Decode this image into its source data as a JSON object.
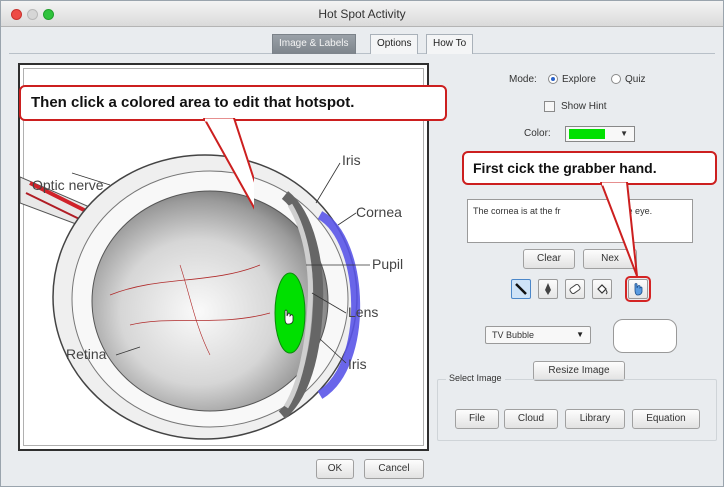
{
  "window": {
    "title": "Hot Spot Activity"
  },
  "tabs": [
    {
      "label": "Image & Labels",
      "active": true
    },
    {
      "label": "Options",
      "active": false
    },
    {
      "label": "How To",
      "active": false
    }
  ],
  "image": {
    "labels": {
      "optic_nerve": "Optic nerve",
      "iris_top": "Iris",
      "cornea": "Cornea",
      "pupil": "Pupil",
      "lens": "Lens",
      "iris_bottom": "Iris",
      "retina": "Retina"
    }
  },
  "mode": {
    "label": "Mode:",
    "options": [
      {
        "label": "Explore",
        "selected": true
      },
      {
        "label": "Quiz",
        "selected": false
      }
    ]
  },
  "show_hint": {
    "label": "Show Hint",
    "checked": false
  },
  "color": {
    "label": "Color:",
    "value": "#00e000"
  },
  "hint_text": "The cornea is at the fr",
  "hint_text_tail": "he eye.",
  "buttons": {
    "clear": "Clear",
    "next": "Nex",
    "resize_image": "Resize Image",
    "file": "File",
    "cloud": "Cloud",
    "library": "Library",
    "equation": "Equation",
    "ok": "OK",
    "cancel": "Cancel"
  },
  "tools": [
    {
      "icon": "line-icon",
      "selected": true
    },
    {
      "icon": "pen-icon",
      "selected": false
    },
    {
      "icon": "eraser-icon",
      "selected": false
    },
    {
      "icon": "fill-bucket-icon",
      "selected": false
    },
    {
      "icon": "grabber-hand-icon",
      "selected": false,
      "highlighted": true
    }
  ],
  "bubble_style": {
    "value": "TV Bubble"
  },
  "select_image": {
    "legend": "Select Image"
  },
  "callouts": {
    "edit_hotspot": "Then click a colored area to edit that hotspot.",
    "grabber": "First cick the grabber hand."
  },
  "colors": {
    "hotspot_green": "#00e000",
    "cornea_blue": "#5a55e8",
    "callout_red": "#cc1f1f"
  }
}
